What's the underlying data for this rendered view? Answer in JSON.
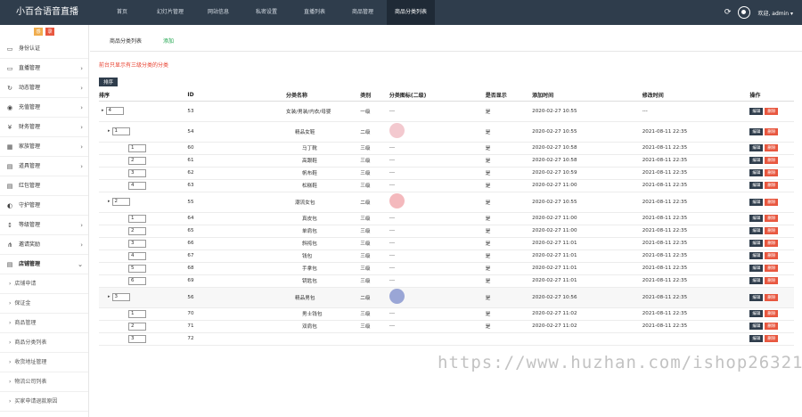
{
  "brand": "小百合语音直播",
  "nav": [
    "首页",
    "幻灯片管理",
    "网站信息",
    "私密设置",
    "直播列表",
    "商品管理",
    "商品分类列表"
  ],
  "user": "欢迎, admin ▾",
  "sidebar": {
    "badges": [
      "感",
      "录"
    ],
    "items": [
      {
        "icon": "▭",
        "label": "身份认证"
      },
      {
        "icon": "▭",
        "label": "直播管理",
        "arrow": "›"
      },
      {
        "icon": "↻",
        "label": "动态管理",
        "arrow": "›"
      },
      {
        "icon": "◉",
        "label": "充值管理",
        "arrow": "›"
      },
      {
        "icon": "¥",
        "label": "财务管理",
        "arrow": "›"
      },
      {
        "icon": "▦",
        "label": "家族管理",
        "arrow": "›"
      },
      {
        "icon": "▤",
        "label": "道具管理",
        "arrow": "›"
      },
      {
        "icon": "▤",
        "label": "红包管理"
      },
      {
        "icon": "◐",
        "label": "守护管理"
      },
      {
        "icon": "↕",
        "label": "等级管理",
        "arrow": "›"
      },
      {
        "icon": "⋔",
        "label": "邀请奖励",
        "arrow": "›"
      },
      {
        "icon": "▤",
        "label": "店铺管理",
        "arrow": "⌄"
      }
    ],
    "subitems": [
      "店铺申请",
      "保证金",
      "商品管理",
      "商品分类列表",
      "收货地址管理",
      "物流公司列表",
      "买家申请退款原因"
    ]
  },
  "tabs": [
    "商品分类列表",
    "添加"
  ],
  "notice": "前台只显示有三级分类的分类",
  "sort_button": "排序",
  "columns": [
    "排序",
    "ID",
    "分类名称",
    "类别",
    "分类图标(二级)",
    "是否显示",
    "添加时间",
    "修改时间",
    "操作"
  ],
  "rows": [
    {
      "sort": "4",
      "id": "53",
      "name": "女装/男装/内衣/母婴",
      "level": "一级",
      "icon": "---",
      "show": "是",
      "added": "2020-02-27 10:55",
      "modified": "---",
      "type": "top"
    },
    {
      "sort": "1",
      "id": "54",
      "name": "精品女鞋",
      "level": "二级",
      "icon": "img1",
      "show": "是",
      "added": "2020-02-27 10:55",
      "modified": "2021-08-11 22:35",
      "type": "second"
    },
    {
      "sort": "1",
      "id": "60",
      "name": "马丁靴",
      "level": "三级",
      "icon": "---",
      "show": "是",
      "added": "2020-02-27 10:58",
      "modified": "2021-08-11 22:35",
      "type": "third"
    },
    {
      "sort": "2",
      "id": "61",
      "name": "高跟鞋",
      "level": "三级",
      "icon": "---",
      "show": "是",
      "added": "2020-02-27 10:58",
      "modified": "2021-08-11 22:35",
      "type": "third"
    },
    {
      "sort": "3",
      "id": "62",
      "name": "帆布鞋",
      "level": "三级",
      "icon": "---",
      "show": "是",
      "added": "2020-02-27 10:59",
      "modified": "2021-08-11 22:35",
      "type": "third"
    },
    {
      "sort": "4",
      "id": "63",
      "name": "松糕鞋",
      "level": "三级",
      "icon": "---",
      "show": "是",
      "added": "2020-02-27 11:00",
      "modified": "2021-08-11 22:35",
      "type": "third"
    },
    {
      "sort": "2",
      "id": "55",
      "name": "潮流女包",
      "level": "二级",
      "icon": "img2",
      "show": "是",
      "added": "2020-02-27 10:55",
      "modified": "2021-08-11 22:35",
      "type": "second"
    },
    {
      "sort": "1",
      "id": "64",
      "name": "真皮包",
      "level": "三级",
      "icon": "---",
      "show": "是",
      "added": "2020-02-27 11:00",
      "modified": "2021-08-11 22:35",
      "type": "third"
    },
    {
      "sort": "2",
      "id": "65",
      "name": "单肩包",
      "level": "三级",
      "icon": "---",
      "show": "是",
      "added": "2020-02-27 11:00",
      "modified": "2021-08-11 22:35",
      "type": "third"
    },
    {
      "sort": "3",
      "id": "66",
      "name": "斜挎包",
      "level": "三级",
      "icon": "---",
      "show": "是",
      "added": "2020-02-27 11:01",
      "modified": "2021-08-11 22:35",
      "type": "third"
    },
    {
      "sort": "4",
      "id": "67",
      "name": "钱包",
      "level": "三级",
      "icon": "---",
      "show": "是",
      "added": "2020-02-27 11:01",
      "modified": "2021-08-11 22:35",
      "type": "third"
    },
    {
      "sort": "5",
      "id": "68",
      "name": "手拿包",
      "level": "三级",
      "icon": "---",
      "show": "是",
      "added": "2020-02-27 11:01",
      "modified": "2021-08-11 22:35",
      "type": "third"
    },
    {
      "sort": "6",
      "id": "69",
      "name": "钥匙包",
      "level": "三级",
      "icon": "---",
      "show": "是",
      "added": "2020-02-27 11:01",
      "modified": "2021-08-11 22:35",
      "type": "third"
    },
    {
      "sort": "3",
      "id": "56",
      "name": "精品男包",
      "level": "二级",
      "icon": "img3",
      "show": "是",
      "added": "2020-02-27 10:56",
      "modified": "2021-08-11 22:35",
      "type": "second"
    },
    {
      "sort": "1",
      "id": "70",
      "name": "男士钱包",
      "level": "三级",
      "icon": "---",
      "show": "是",
      "added": "2020-02-27 11:02",
      "modified": "2021-08-11 22:35",
      "type": "third"
    },
    {
      "sort": "2",
      "id": "71",
      "name": "双肩包",
      "level": "三级",
      "icon": "---",
      "show": "是",
      "added": "2020-02-27 11:02",
      "modified": "2021-08-11 22:35",
      "type": "third"
    },
    {
      "sort": "3",
      "id": "72",
      "name": "",
      "level": "",
      "icon": "",
      "show": "",
      "added": "",
      "modified": "",
      "type": "third"
    }
  ],
  "actions": {
    "edit": "编辑",
    "delete": "删除"
  },
  "icon_colors": {
    "img1": "#f3c9cf",
    "img2": "#f4b9bd",
    "img3": "#9aa6d6"
  },
  "watermark": "https://www.huzhan.com/ishop26321"
}
